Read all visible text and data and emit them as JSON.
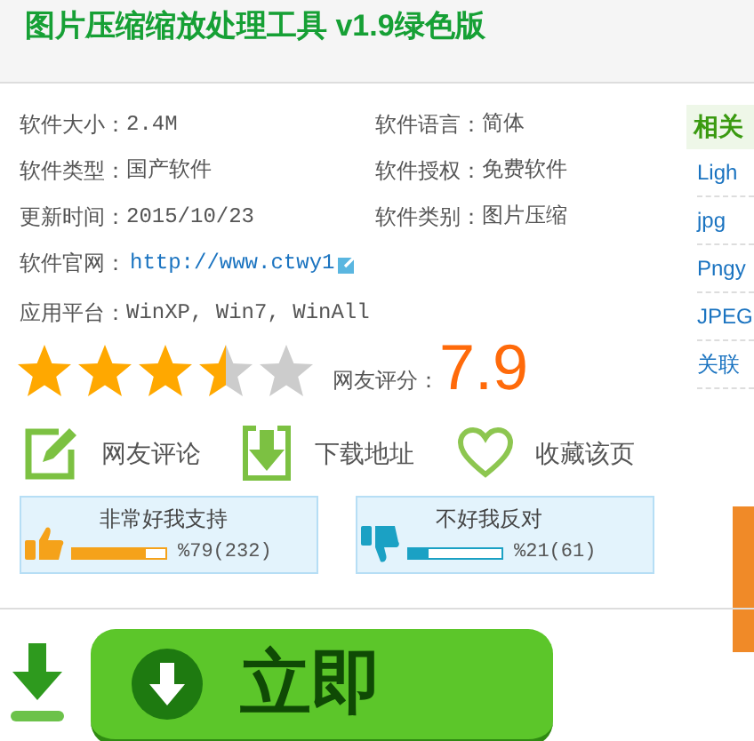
{
  "title": "图片压缩缩放处理工具 v1.9绿色版",
  "info": [
    {
      "label": "软件大小：",
      "value": "2.4M"
    },
    {
      "label": "软件语言：",
      "value": "简体"
    },
    {
      "label": "软件类型：",
      "value": "国产软件"
    },
    {
      "label": "软件授权：",
      "value": "免费软件"
    },
    {
      "label": "更新时间：",
      "value": "2015/10/23"
    },
    {
      "label": "软件类别：",
      "value": "图片压缩"
    }
  ],
  "website": {
    "label": "软件官网：",
    "link": "http://www.ctwy1"
  },
  "platform": {
    "label": "应用平台：",
    "value": "WinXP, Win7, WinAll"
  },
  "rating": {
    "stars": 3.5,
    "label": "网友评分：",
    "score": "7.9"
  },
  "actions": [
    {
      "kind": "comment",
      "label": "网友评论"
    },
    {
      "kind": "download",
      "label": "下载地址"
    },
    {
      "kind": "favorite",
      "label": "收藏该页"
    }
  ],
  "votes": [
    {
      "kind": "up",
      "label": "非常好我支持",
      "level": 0.79,
      "reading": "%79(232)"
    },
    {
      "kind": "down",
      "label": "不好我反对",
      "level": 0.21,
      "reading": "%21(61)"
    }
  ],
  "download_button": {
    "label": "立即"
  },
  "sidebar": {
    "title": "相关",
    "items": [
      "Ligh",
      "jpg",
      "Pngy",
      "JPEG",
      "关联"
    ]
  }
}
